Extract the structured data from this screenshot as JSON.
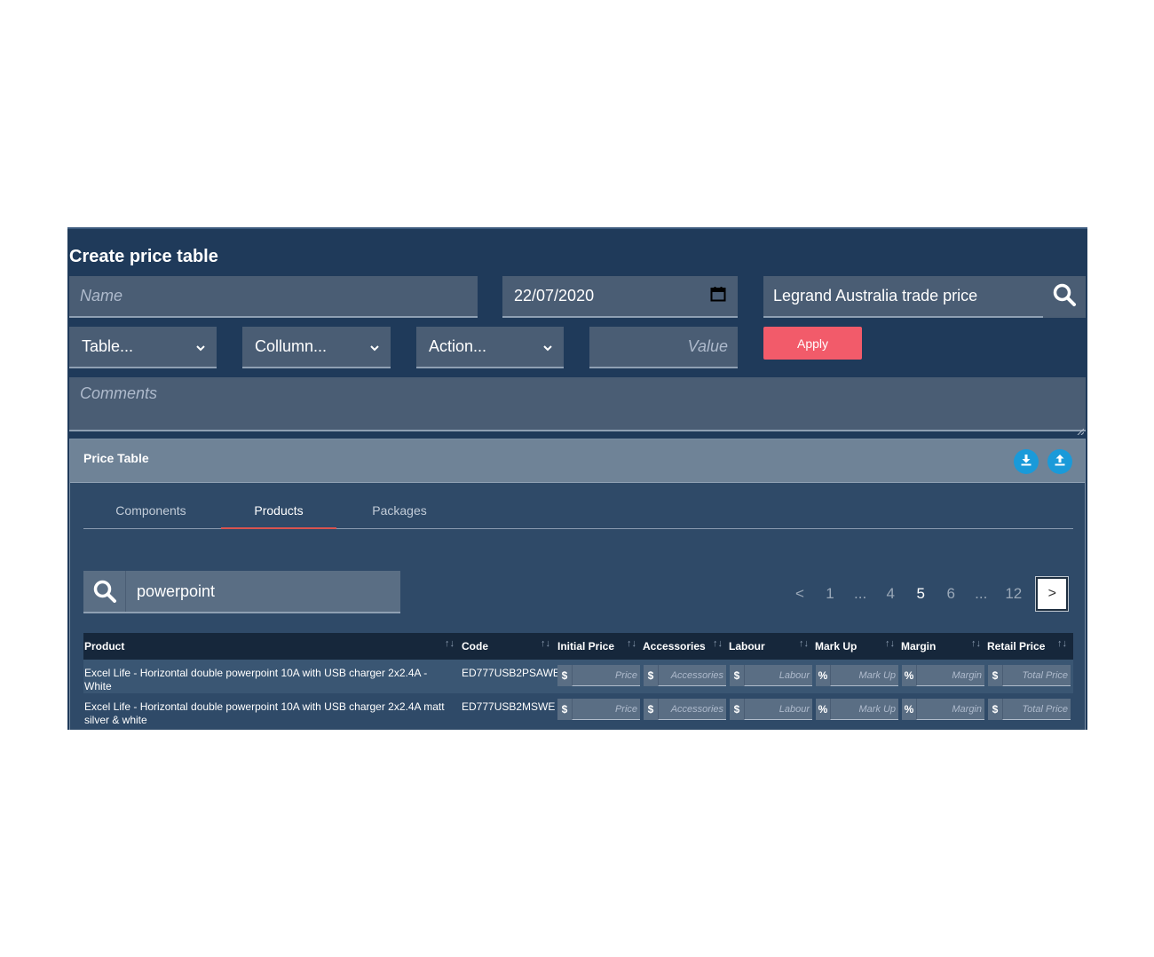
{
  "page": {
    "title": "Create price table",
    "name_placeholder": "Name",
    "date_value": "22/07/2020",
    "price_list_value": "Legrand Australia trade price",
    "table_select": "Table...",
    "column_select": "Collumn...",
    "action_select": "Action...",
    "value_placeholder": "Value",
    "apply_label": "Apply",
    "comments_placeholder": "Comments"
  },
  "panel": {
    "title": "Price Table",
    "tabs": [
      {
        "label": "Components"
      },
      {
        "label": "Products"
      },
      {
        "label": "Packages"
      }
    ],
    "search_value": "powerpoint",
    "pager": [
      "<",
      "1",
      "...",
      "4",
      "5",
      "6",
      "...",
      "12",
      ">"
    ],
    "active_page": "5"
  },
  "table": {
    "headers": [
      "Product",
      "Code",
      "Initial Price",
      "Accessories",
      "Labour",
      "Mark Up",
      "Margin",
      "Retail Price"
    ],
    "input_placeholders": [
      "Price",
      "Accessories",
      "Labour",
      "Mark Up",
      "Margin",
      "Total Price"
    ],
    "input_prefixes": [
      "$",
      "$",
      "$",
      "%",
      "%",
      "$"
    ],
    "rows": [
      {
        "product": "Excel Life - Horizontal double powerpoint 10A with USB charger 2x2.4A - White",
        "code": "ED777USB2PSAWE"
      },
      {
        "product": "Excel Life - Horizontal double powerpoint 10A with USB charger 2x2.4A matt silver & white",
        "code": "ED777USB2MSWE"
      }
    ]
  },
  "colors": {
    "background": "#1f3a5a",
    "field": "#4a5d74",
    "apply": "#f25b6a",
    "panel_header": "#6f8397",
    "action_button": "#1a9ad9",
    "tab_active_underline": "#d9534f"
  },
  "icons": [
    "calendar-icon",
    "search-icon",
    "chevron-down-icon",
    "download-icon",
    "upload-icon",
    "sort-icon"
  ]
}
